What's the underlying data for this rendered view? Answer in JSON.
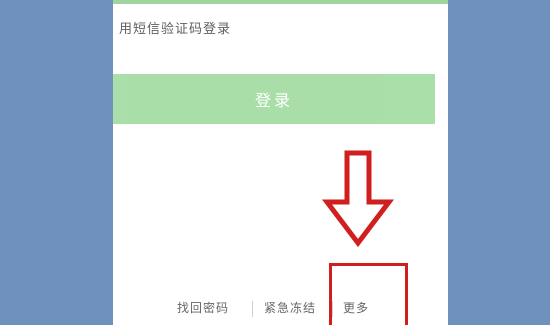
{
  "login": {
    "sms_link": "用短信验证码登录",
    "button_label": "登录"
  },
  "footer": {
    "find_password": "找回密码",
    "emergency_freeze": "紧急冻结",
    "more": "更多"
  },
  "annotation": {
    "arrow_color": "#d11f1f",
    "box_color": "#d11f1f",
    "arrow_icon": "down-arrow-icon"
  },
  "colors": {
    "background": "#6f91bd",
    "login_button": "#a2dca2",
    "accent": "#9fd49f"
  }
}
